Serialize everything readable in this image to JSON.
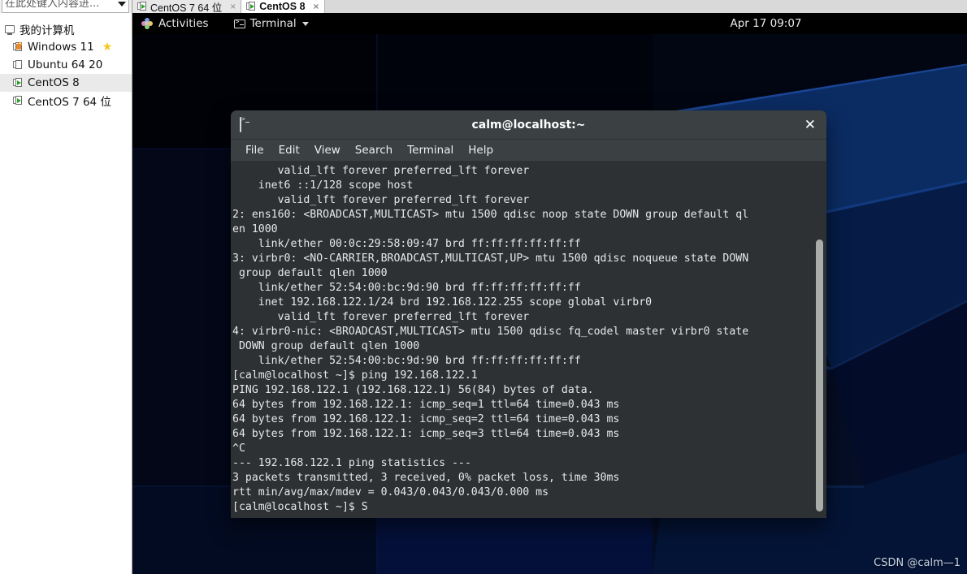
{
  "host": {
    "search": {
      "placeholder": "在此处键入内容进...",
      "icon": "chevron-down-icon"
    },
    "tabs": [
      {
        "label": "CentOS 7 64 位",
        "active": false,
        "close": "×",
        "icon": "vm-powered-icon"
      },
      {
        "label": "CentOS 8",
        "active": true,
        "close": "×",
        "icon": "vm-powered-icon"
      }
    ],
    "library": {
      "root_label": "我的计算机",
      "items": [
        {
          "label": "Windows 11",
          "icon": "vm-locked-icon",
          "favorite": "★",
          "selected": false
        },
        {
          "label": "Ubuntu 64 20",
          "icon": "vm-off-icon",
          "favorite": "",
          "selected": false
        },
        {
          "label": "CentOS 8",
          "icon": "vm-powered-icon",
          "favorite": "",
          "selected": true
        },
        {
          "label": "CentOS 7 64 位",
          "icon": "vm-powered-icon",
          "favorite": "",
          "selected": false
        }
      ]
    }
  },
  "guest": {
    "topbar": {
      "activities": "Activities",
      "app_menu": "Terminal",
      "clock": "Apr 17 09:07"
    },
    "terminal": {
      "title": "calm@localhost:~",
      "close": "✕",
      "menu": [
        "File",
        "Edit",
        "View",
        "Search",
        "Terminal",
        "Help"
      ],
      "lines": [
        "       valid_lft forever preferred_lft forever",
        "    inet6 ::1/128 scope host",
        "       valid_lft forever preferred_lft forever",
        "2: ens160: <BROADCAST,MULTICAST> mtu 1500 qdisc noop state DOWN group default ql",
        "en 1000",
        "    link/ether 00:0c:29:58:09:47 brd ff:ff:ff:ff:ff:ff",
        "3: virbr0: <NO-CARRIER,BROADCAST,MULTICAST,UP> mtu 1500 qdisc noqueue state DOWN",
        " group default qlen 1000",
        "    link/ether 52:54:00:bc:9d:90 brd ff:ff:ff:ff:ff:ff",
        "    inet 192.168.122.1/24 brd 192.168.122.255 scope global virbr0",
        "       valid_lft forever preferred_lft forever",
        "4: virbr0-nic: <BROADCAST,MULTICAST> mtu 1500 qdisc fq_codel master virbr0 state",
        " DOWN group default qlen 1000",
        "    link/ether 52:54:00:bc:9d:90 brd ff:ff:ff:ff:ff:ff",
        "[calm@localhost ~]$ ping 192.168.122.1",
        "PING 192.168.122.1 (192.168.122.1) 56(84) bytes of data.",
        "64 bytes from 192.168.122.1: icmp_seq=1 ttl=64 time=0.043 ms",
        "64 bytes from 192.168.122.1: icmp_seq=2 ttl=64 time=0.043 ms",
        "64 bytes from 192.168.122.1: icmp_seq=3 ttl=64 time=0.043 ms",
        "^C",
        "--- 192.168.122.1 ping statistics ---",
        "3 packets transmitted, 3 received, 0% packet loss, time 30ms",
        "rtt min/avg/max/mdev = 0.043/0.043/0.043/0.000 ms",
        "[calm@localhost ~]$ S"
      ]
    }
  },
  "watermark": "CSDN @calm—1",
  "colors": {
    "term_bg": "#2d3134",
    "term_chrome": "#3b4043",
    "desktop": "#050a1e",
    "accent_green": "#2aa12a"
  }
}
